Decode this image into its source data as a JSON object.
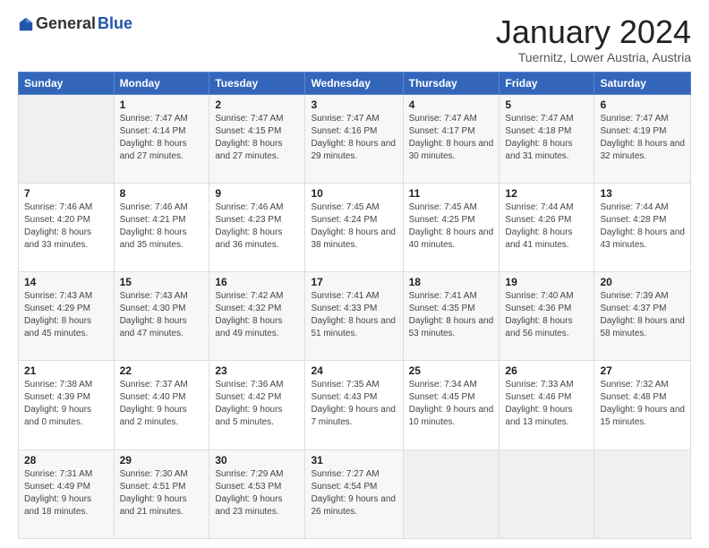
{
  "logo": {
    "general": "General",
    "blue": "Blue"
  },
  "title": "January 2024",
  "location": "Tuernitz, Lower Austria, Austria",
  "weekdays": [
    "Sunday",
    "Monday",
    "Tuesday",
    "Wednesday",
    "Thursday",
    "Friday",
    "Saturday"
  ],
  "weeks": [
    [
      {
        "day": "",
        "sunrise": "",
        "sunset": "",
        "daylight": ""
      },
      {
        "day": "1",
        "sunrise": "Sunrise: 7:47 AM",
        "sunset": "Sunset: 4:14 PM",
        "daylight": "Daylight: 8 hours and 27 minutes."
      },
      {
        "day": "2",
        "sunrise": "Sunrise: 7:47 AM",
        "sunset": "Sunset: 4:15 PM",
        "daylight": "Daylight: 8 hours and 27 minutes."
      },
      {
        "day": "3",
        "sunrise": "Sunrise: 7:47 AM",
        "sunset": "Sunset: 4:16 PM",
        "daylight": "Daylight: 8 hours and 29 minutes."
      },
      {
        "day": "4",
        "sunrise": "Sunrise: 7:47 AM",
        "sunset": "Sunset: 4:17 PM",
        "daylight": "Daylight: 8 hours and 30 minutes."
      },
      {
        "day": "5",
        "sunrise": "Sunrise: 7:47 AM",
        "sunset": "Sunset: 4:18 PM",
        "daylight": "Daylight: 8 hours and 31 minutes."
      },
      {
        "day": "6",
        "sunrise": "Sunrise: 7:47 AM",
        "sunset": "Sunset: 4:19 PM",
        "daylight": "Daylight: 8 hours and 32 minutes."
      }
    ],
    [
      {
        "day": "7",
        "sunrise": "Sunrise: 7:46 AM",
        "sunset": "Sunset: 4:20 PM",
        "daylight": "Daylight: 8 hours and 33 minutes."
      },
      {
        "day": "8",
        "sunrise": "Sunrise: 7:46 AM",
        "sunset": "Sunset: 4:21 PM",
        "daylight": "Daylight: 8 hours and 35 minutes."
      },
      {
        "day": "9",
        "sunrise": "Sunrise: 7:46 AM",
        "sunset": "Sunset: 4:23 PM",
        "daylight": "Daylight: 8 hours and 36 minutes."
      },
      {
        "day": "10",
        "sunrise": "Sunrise: 7:45 AM",
        "sunset": "Sunset: 4:24 PM",
        "daylight": "Daylight: 8 hours and 38 minutes."
      },
      {
        "day": "11",
        "sunrise": "Sunrise: 7:45 AM",
        "sunset": "Sunset: 4:25 PM",
        "daylight": "Daylight: 8 hours and 40 minutes."
      },
      {
        "day": "12",
        "sunrise": "Sunrise: 7:44 AM",
        "sunset": "Sunset: 4:26 PM",
        "daylight": "Daylight: 8 hours and 41 minutes."
      },
      {
        "day": "13",
        "sunrise": "Sunrise: 7:44 AM",
        "sunset": "Sunset: 4:28 PM",
        "daylight": "Daylight: 8 hours and 43 minutes."
      }
    ],
    [
      {
        "day": "14",
        "sunrise": "Sunrise: 7:43 AM",
        "sunset": "Sunset: 4:29 PM",
        "daylight": "Daylight: 8 hours and 45 minutes."
      },
      {
        "day": "15",
        "sunrise": "Sunrise: 7:43 AM",
        "sunset": "Sunset: 4:30 PM",
        "daylight": "Daylight: 8 hours and 47 minutes."
      },
      {
        "day": "16",
        "sunrise": "Sunrise: 7:42 AM",
        "sunset": "Sunset: 4:32 PM",
        "daylight": "Daylight: 8 hours and 49 minutes."
      },
      {
        "day": "17",
        "sunrise": "Sunrise: 7:41 AM",
        "sunset": "Sunset: 4:33 PM",
        "daylight": "Daylight: 8 hours and 51 minutes."
      },
      {
        "day": "18",
        "sunrise": "Sunrise: 7:41 AM",
        "sunset": "Sunset: 4:35 PM",
        "daylight": "Daylight: 8 hours and 53 minutes."
      },
      {
        "day": "19",
        "sunrise": "Sunrise: 7:40 AM",
        "sunset": "Sunset: 4:36 PM",
        "daylight": "Daylight: 8 hours and 56 minutes."
      },
      {
        "day": "20",
        "sunrise": "Sunrise: 7:39 AM",
        "sunset": "Sunset: 4:37 PM",
        "daylight": "Daylight: 8 hours and 58 minutes."
      }
    ],
    [
      {
        "day": "21",
        "sunrise": "Sunrise: 7:38 AM",
        "sunset": "Sunset: 4:39 PM",
        "daylight": "Daylight: 9 hours and 0 minutes."
      },
      {
        "day": "22",
        "sunrise": "Sunrise: 7:37 AM",
        "sunset": "Sunset: 4:40 PM",
        "daylight": "Daylight: 9 hours and 2 minutes."
      },
      {
        "day": "23",
        "sunrise": "Sunrise: 7:36 AM",
        "sunset": "Sunset: 4:42 PM",
        "daylight": "Daylight: 9 hours and 5 minutes."
      },
      {
        "day": "24",
        "sunrise": "Sunrise: 7:35 AM",
        "sunset": "Sunset: 4:43 PM",
        "daylight": "Daylight: 9 hours and 7 minutes."
      },
      {
        "day": "25",
        "sunrise": "Sunrise: 7:34 AM",
        "sunset": "Sunset: 4:45 PM",
        "daylight": "Daylight: 9 hours and 10 minutes."
      },
      {
        "day": "26",
        "sunrise": "Sunrise: 7:33 AM",
        "sunset": "Sunset: 4:46 PM",
        "daylight": "Daylight: 9 hours and 13 minutes."
      },
      {
        "day": "27",
        "sunrise": "Sunrise: 7:32 AM",
        "sunset": "Sunset: 4:48 PM",
        "daylight": "Daylight: 9 hours and 15 minutes."
      }
    ],
    [
      {
        "day": "28",
        "sunrise": "Sunrise: 7:31 AM",
        "sunset": "Sunset: 4:49 PM",
        "daylight": "Daylight: 9 hours and 18 minutes."
      },
      {
        "day": "29",
        "sunrise": "Sunrise: 7:30 AM",
        "sunset": "Sunset: 4:51 PM",
        "daylight": "Daylight: 9 hours and 21 minutes."
      },
      {
        "day": "30",
        "sunrise": "Sunrise: 7:29 AM",
        "sunset": "Sunset: 4:53 PM",
        "daylight": "Daylight: 9 hours and 23 minutes."
      },
      {
        "day": "31",
        "sunrise": "Sunrise: 7:27 AM",
        "sunset": "Sunset: 4:54 PM",
        "daylight": "Daylight: 9 hours and 26 minutes."
      },
      {
        "day": "",
        "sunrise": "",
        "sunset": "",
        "daylight": ""
      },
      {
        "day": "",
        "sunrise": "",
        "sunset": "",
        "daylight": ""
      },
      {
        "day": "",
        "sunrise": "",
        "sunset": "",
        "daylight": ""
      }
    ]
  ]
}
